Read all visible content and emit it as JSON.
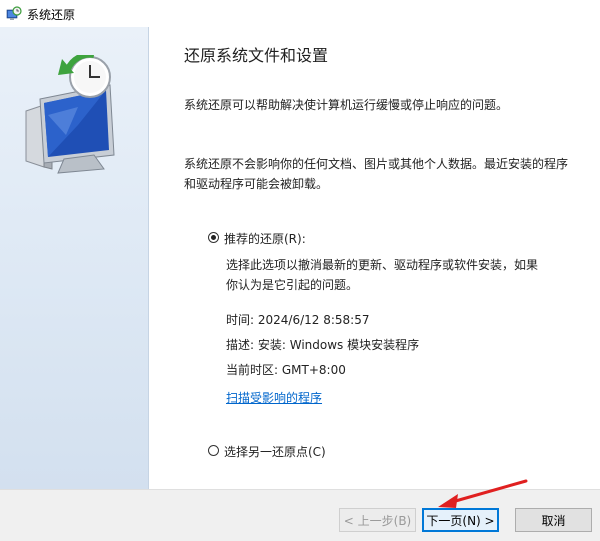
{
  "window": {
    "title": "系统还原"
  },
  "content": {
    "heading": "还原系统文件和设置",
    "intro": "系统还原可以帮助解决使计算机运行缓慢或停止响应的问题。",
    "note": "系统还原不会影响你的任何文档、图片或其他个人数据。最近安装的程序和驱动程序可能会被卸载。",
    "recommended": {
      "label": "推荐的还原(R):",
      "selected": true,
      "description": "选择此选项以撤消最新的更新、驱动程序或软件安装，如果你认为是它引起的问题。",
      "time": "时间: 2024/6/12 8:58:57",
      "desc": "描述: 安装: Windows 模块安装程序",
      "timezone": "当前时区: GMT+8:00",
      "link": "扫描受影响的程序"
    },
    "other": {
      "label": "选择另一还原点(C)",
      "selected": false
    }
  },
  "footer": {
    "back": "< 上一步(B)",
    "next": "下一页(N) >",
    "cancel": "取消"
  },
  "colors": {
    "accent": "#0078d7",
    "link": "#0066cc",
    "annotation_arrow": "#e02020"
  }
}
